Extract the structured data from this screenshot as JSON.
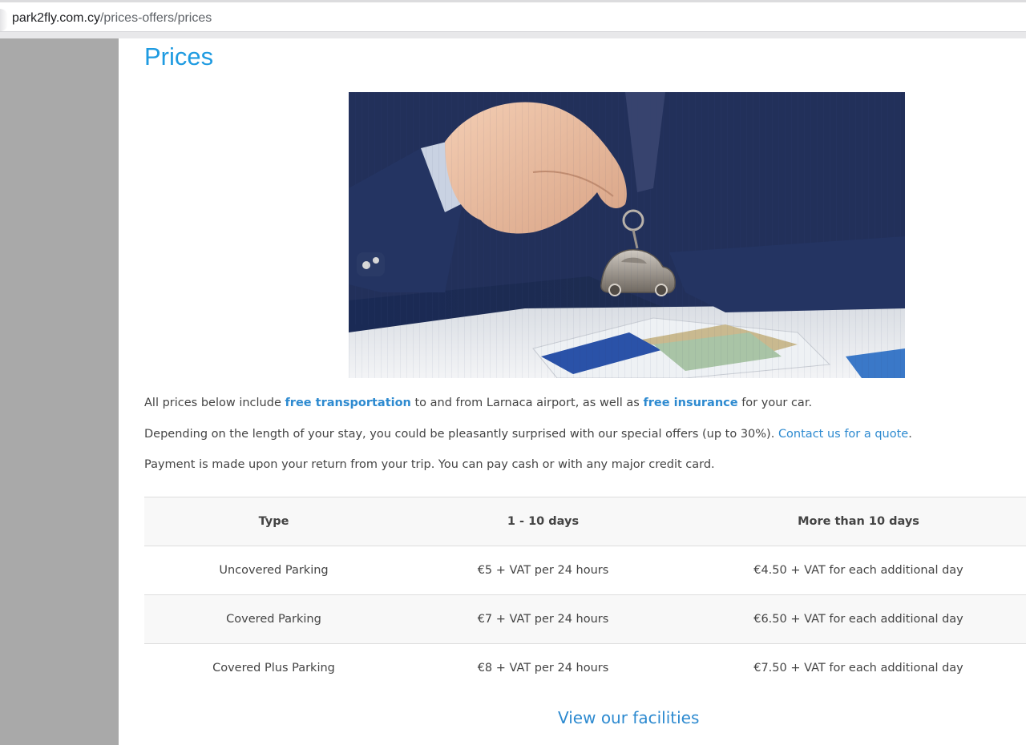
{
  "browser": {
    "url_domain": "park2fly.com.cy",
    "url_path": "/prices-offers/prices"
  },
  "page": {
    "title": "Prices"
  },
  "intro": {
    "p1_before": "All prices below include ",
    "p1_link1": "free transportation",
    "p1_mid": " to and from Larnaca airport, as well as ",
    "p1_link2": "free insurance",
    "p1_after": " for your car.",
    "p2_before": "Depending on the length of your stay, you could be pleasantly surprised with our special offers (up to 30%). ",
    "p2_link": "Contact us for a quote",
    "p2_after": ".",
    "p3": "Payment is made upon your return from your trip. You can pay cash or with any major credit card."
  },
  "table": {
    "headers": [
      "Type",
      "1 - 10 days",
      "More than 10 days"
    ],
    "rows": [
      [
        "Uncovered Parking",
        "€5 + VAT per 24 hours",
        "€4.50 + VAT for each additional day"
      ],
      [
        "Covered Parking",
        "€7 + VAT per 24 hours",
        "€6.50 + VAT for each additional day"
      ],
      [
        "Covered Plus Parking",
        "€8 + VAT per 24 hours",
        "€7.50 + VAT for each additional day"
      ]
    ]
  },
  "footer": {
    "facilities_link": "View our facilities"
  },
  "colors": {
    "title": "#1f9be1",
    "link": "#2d8ad0",
    "text": "#444444",
    "gutter": "#a9a9a9"
  }
}
